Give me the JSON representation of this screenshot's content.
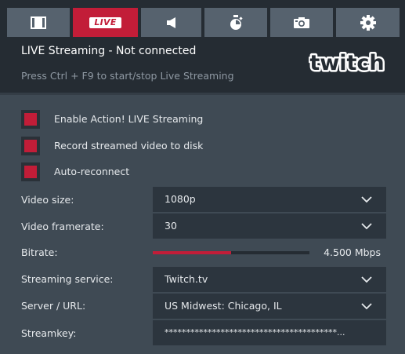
{
  "tabs": [
    {
      "icon": "film-icon",
      "active": false
    },
    {
      "label": "LIVE",
      "icon": "live-badge",
      "active": true
    },
    {
      "icon": "speaker-icon",
      "active": false
    },
    {
      "icon": "stopwatch-icon",
      "active": false
    },
    {
      "icon": "camera-icon",
      "active": false
    },
    {
      "icon": "gear-icon",
      "active": false
    }
  ],
  "header": {
    "title": "LIVE Streaming - Not connected",
    "hint": "Press Ctrl + F9 to start/stop Live Streaming",
    "logo_text": "twitch"
  },
  "checkboxes": [
    {
      "label": "Enable Action! LIVE Streaming",
      "checked": true
    },
    {
      "label": "Record streamed video to disk",
      "checked": true
    },
    {
      "label": "Auto-reconnect",
      "checked": true
    }
  ],
  "fields": {
    "video_size": {
      "label": "Video size:",
      "value": "1080p"
    },
    "video_framerate": {
      "label": "Video framerate:",
      "value": "30"
    },
    "bitrate": {
      "label": "Bitrate:",
      "value": "4.500 Mbps",
      "level": 0.5
    },
    "streaming_service": {
      "label": "Streaming service:",
      "value": "Twitch.tv"
    },
    "server_url": {
      "label": "Server / URL:",
      "value": "US Midwest: Chicago, IL"
    },
    "streamkey": {
      "label": "Streamkey:",
      "value": "****************************************..."
    }
  },
  "colors": {
    "accent": "#c21d38",
    "background": "#3f4a54",
    "header": "#252c33",
    "tab": "#56626e",
    "field": "#2c353e"
  }
}
